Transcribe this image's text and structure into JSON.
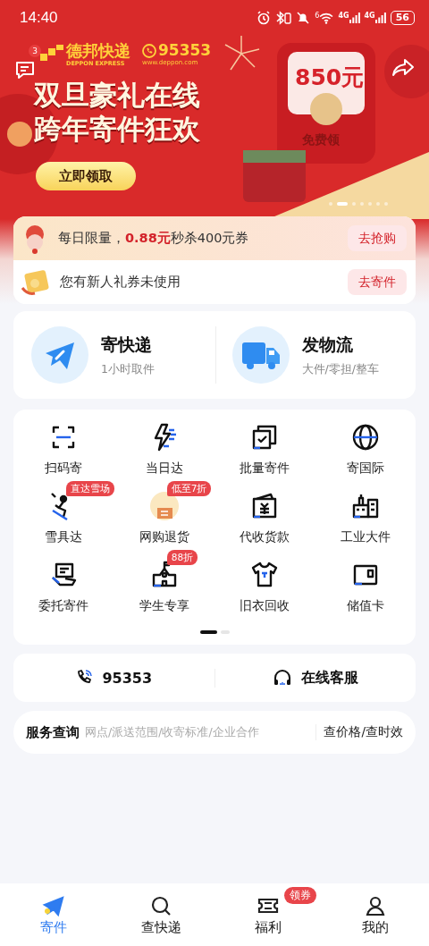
{
  "status_bar": {
    "time": "14:40",
    "wifi_label": "6",
    "networks": [
      "4G",
      "4G"
    ],
    "battery": "56"
  },
  "banner": {
    "message_badge": "3",
    "brand": "德邦快递",
    "brand_en": "DEPPON EXPRESS",
    "hotline": "95353",
    "website": "www.deppon.com",
    "headline": [
      "双旦豪礼在线",
      "跨年寄件狂欢"
    ],
    "cta": "立即领取",
    "envelope_amount": "850元",
    "envelope_label": "免费领",
    "dots": [
      {
        "selected": false
      },
      {
        "selected": true
      },
      {
        "selected": false
      },
      {
        "selected": false
      },
      {
        "selected": false
      },
      {
        "selected": false
      },
      {
        "selected": false
      }
    ]
  },
  "notices": [
    {
      "text": "每日限量，**0.88元**秒杀400元券",
      "action": "去抢购",
      "highlight": true
    },
    {
      "text": "您有新人礼券未使用",
      "action": "去寄件",
      "highlight": false
    }
  ],
  "services": [
    {
      "title": "寄快递",
      "subtitle": "1小时取件"
    },
    {
      "title": "发物流",
      "subtitle": "大件/零担/整车"
    }
  ],
  "grid": [
    {
      "label": "扫码寄"
    },
    {
      "label": "当日达"
    },
    {
      "label": "批量寄件"
    },
    {
      "label": "寄国际"
    },
    {
      "label": "雪具达",
      "badge": "直达雪场"
    },
    {
      "label": "网购退货",
      "badge": "低至7折"
    },
    {
      "label": "代收货款"
    },
    {
      "label": "工业大件"
    },
    {
      "label": "委托寄件"
    },
    {
      "label": "学生专享",
      "badge": "88折"
    },
    {
      "label": "旧衣回收"
    },
    {
      "label": "储值卡"
    }
  ],
  "grid_pages": [
    {
      "selected": true
    },
    {
      "selected": false
    }
  ],
  "contact": {
    "phone": "95353",
    "online": "在线客服"
  },
  "query": {
    "title": "服务查询",
    "hint": "网点/派送范围/收寄标准/企业合作",
    "action": "查价格/查时效"
  },
  "tabs": [
    {
      "label": "寄件",
      "selected": true
    },
    {
      "label": "查快递",
      "selected": false
    },
    {
      "label": "福利",
      "selected": false,
      "badge": "领券"
    },
    {
      "label": "我的",
      "selected": false
    }
  ]
}
